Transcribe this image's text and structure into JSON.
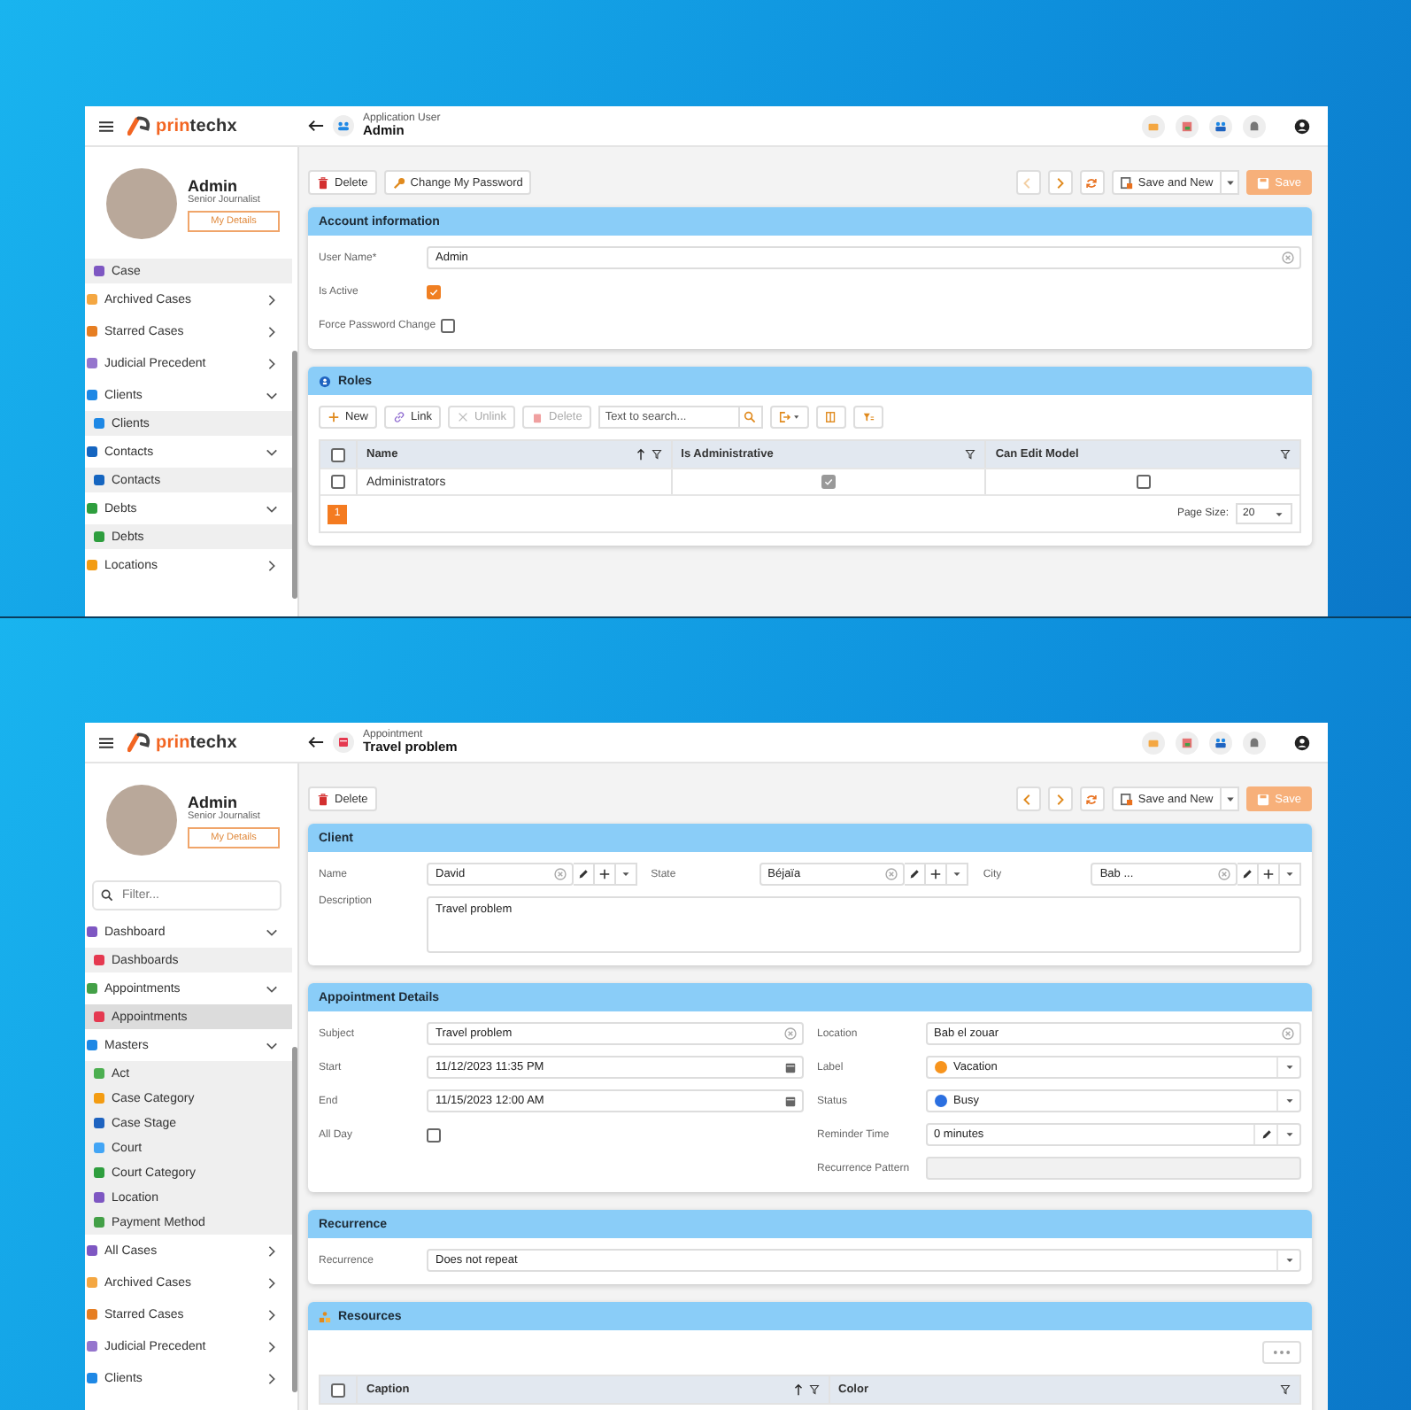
{
  "screens": [
    {
      "logo": {
        "accent": "prin",
        "rest": "techx"
      },
      "profile": {
        "name": "Admin",
        "role": "Senior Journalist",
        "button": "My Details"
      },
      "sidebar": {
        "items": [
          {
            "kind": "child",
            "label": "Case",
            "color": "#7e57c2",
            "selected": false
          },
          {
            "kind": "group",
            "label": "Archived Cases",
            "color": "#f4a742",
            "expanded": false
          },
          {
            "kind": "group",
            "label": "Starred Cases",
            "color": "#e67e22",
            "expanded": false
          },
          {
            "kind": "group",
            "label": "Judicial Precedent",
            "color": "#9575cd",
            "expanded": false
          },
          {
            "kind": "group",
            "label": "Clients",
            "color": "#1e88e5",
            "expanded": true,
            "children": [
              {
                "label": "Clients",
                "color": "#1e88e5",
                "selected": false
              }
            ]
          },
          {
            "kind": "group",
            "label": "Contacts",
            "color": "#1565c0",
            "expanded": true,
            "children": [
              {
                "label": "Contacts",
                "color": "#1565c0",
                "selected": false
              }
            ]
          },
          {
            "kind": "group",
            "label": "Debts",
            "color": "#2e9e3e",
            "expanded": true,
            "children": [
              {
                "label": "Debts",
                "color": "#2e9e3e",
                "selected": false
              }
            ]
          },
          {
            "kind": "group",
            "label": "Locations",
            "color": "#f39c12",
            "expanded": false
          }
        ]
      },
      "header": {
        "subtitle": "Application User",
        "title": "Admin"
      },
      "toolbar": {
        "actions": [
          {
            "kind": "delete",
            "label": "Delete"
          },
          {
            "kind": "password",
            "label": "Change My Password"
          }
        ],
        "prev_disabled": true,
        "next_disabled": false,
        "save_and_new": "Save and New",
        "save": {
          "label": "Save",
          "disabled": true
        }
      },
      "panels": [
        {
          "kind": "form",
          "title": "Account information",
          "sections": [
            {
              "columns": [
                [
                  {
                    "kind": "text",
                    "label": "User Name*",
                    "value": "Admin"
                  },
                  {
                    "kind": "checkbox",
                    "label": "Is Active",
                    "checked": true
                  },
                  {
                    "kind": "checkbox",
                    "label": "Force Password Change",
                    "checked": false
                  }
                ]
              ]
            }
          ]
        },
        {
          "kind": "grid",
          "title": "Roles",
          "toolbar": [
            {
              "kind": "new",
              "label": "New",
              "disabled": false
            },
            {
              "kind": "link",
              "label": "Link",
              "disabled": false
            },
            {
              "kind": "unlink",
              "label": "Unlink",
              "disabled": true
            },
            {
              "kind": "delete",
              "label": "Delete",
              "disabled": true
            },
            {
              "kind": "search",
              "placeholder": "Text to search..."
            },
            {
              "kind": "export"
            },
            {
              "kind": "columns"
            },
            {
              "kind": "filter"
            }
          ],
          "all_selected": false,
          "columns": [
            {
              "label": "Name",
              "sorted": true
            },
            {
              "label": "Is Administrative",
              "sorted": false
            },
            {
              "label": "Can Edit Model",
              "sorted": false
            }
          ],
          "rows": [
            {
              "selected": false,
              "cells": [
                {
                  "kind": "text",
                  "value": "Administrators"
                },
                {
                  "kind": "checkbox",
                  "checked": true
                },
                {
                  "kind": "checkbox",
                  "checked": false
                }
              ]
            }
          ],
          "pager": {
            "pages": [
              {
                "label": "1",
                "selected": true
              }
            ],
            "page_size_label": "Page Size:",
            "page_size": "20"
          }
        }
      ]
    },
    {
      "logo": {
        "accent": "prin",
        "rest": "techx"
      },
      "profile": {
        "name": "Admin",
        "role": "Senior Journalist",
        "button": "My Details"
      },
      "filter": {
        "placeholder": "Filter..."
      },
      "sidebar": {
        "items": [
          {
            "kind": "group",
            "label": "Dashboard",
            "color": "#7e57c2",
            "expanded": true,
            "children": [
              {
                "label": "Dashboards",
                "color": "#e53950",
                "selected": false
              }
            ]
          },
          {
            "kind": "group",
            "label": "Appointments",
            "color": "#43a047",
            "expanded": true,
            "children": [
              {
                "label": "Appointments",
                "color": "#e53950",
                "selected": true
              }
            ]
          },
          {
            "kind": "group",
            "label": "Masters",
            "color": "#1e88e5",
            "expanded": true,
            "children": [
              {
                "label": "Act",
                "color": "#4caf50",
                "selected": false
              },
              {
                "label": "Case Category",
                "color": "#f39c12",
                "selected": false
              },
              {
                "label": "Case Stage",
                "color": "#1e63c0",
                "selected": false
              },
              {
                "label": "Court",
                "color": "#42a5f5",
                "selected": false
              },
              {
                "label": "Court Category",
                "color": "#2e9e3e",
                "selected": false
              },
              {
                "label": "Location",
                "color": "#7e57c2",
                "selected": false
              },
              {
                "label": "Payment Method",
                "color": "#43a047",
                "selected": false
              }
            ]
          },
          {
            "kind": "group",
            "label": "All Cases",
            "color": "#7e57c2",
            "expanded": false
          },
          {
            "kind": "group",
            "label": "Archived Cases",
            "color": "#f4a742",
            "expanded": false
          },
          {
            "kind": "group",
            "label": "Starred Cases",
            "color": "#e67e22",
            "expanded": false
          },
          {
            "kind": "group",
            "label": "Judicial Precedent",
            "color": "#9575cd",
            "expanded": false
          },
          {
            "kind": "group",
            "label": "Clients",
            "color": "#1e88e5",
            "expanded": false
          }
        ]
      },
      "header": {
        "subtitle": "Appointment",
        "title": "Travel problem"
      },
      "toolbar": {
        "actions": [
          {
            "kind": "delete",
            "label": "Delete"
          }
        ],
        "prev_disabled": false,
        "next_disabled": false,
        "save_and_new": "Save and New",
        "save": {
          "label": "Save",
          "disabled": true
        }
      },
      "panels": [
        {
          "kind": "form",
          "title": "Client",
          "sections": [
            {
              "columns": [
                [
                  {
                    "kind": "lookup",
                    "label": "Name",
                    "value": "David"
                  }
                ],
                [
                  {
                    "kind": "lookup",
                    "label": "State",
                    "value": "Béjaïa"
                  }
                ],
                [
                  {
                    "kind": "lookup",
                    "label": "City",
                    "value": "Bab ..."
                  }
                ]
              ]
            },
            {
              "columns": [
                [
                  {
                    "kind": "textarea",
                    "label": "Description",
                    "value": "Travel problem"
                  }
                ]
              ]
            }
          ]
        },
        {
          "kind": "form",
          "title": "Appointment Details",
          "sections": [
            {
              "columns": [
                [
                  {
                    "kind": "text",
                    "label": "Subject",
                    "value": "Travel problem"
                  },
                  {
                    "kind": "date",
                    "label": "Start",
                    "value": "11/12/2023 11:35 PM"
                  },
                  {
                    "kind": "date",
                    "label": "End",
                    "value": "11/15/2023 12:00 AM"
                  },
                  {
                    "kind": "checkbox",
                    "label": "All Day",
                    "checked": false
                  }
                ],
                [
                  {
                    "kind": "text",
                    "label": "Location",
                    "value": "Bab el zouar"
                  },
                  {
                    "kind": "select",
                    "label": "Label",
                    "value": "Vacation",
                    "color": "#f7941d"
                  },
                  {
                    "kind": "select",
                    "label": "Status",
                    "value": "Busy",
                    "color": "#2b6fe0"
                  },
                  {
                    "kind": "select_edit",
                    "label": "Reminder Time",
                    "value": "0 minutes"
                  },
                  {
                    "kind": "disabled",
                    "label": "Recurrence Pattern"
                  }
                ]
              ]
            }
          ]
        },
        {
          "kind": "form",
          "title": "Recurrence",
          "sections": [
            {
              "columns": [
                [
                  {
                    "kind": "select",
                    "label": "Recurrence",
                    "value": "Does not repeat"
                  }
                ]
              ]
            }
          ]
        },
        {
          "kind": "grid",
          "title": "Resources",
          "toolbar": [
            {
              "kind": "more"
            }
          ],
          "all_selected": false,
          "columns": [
            {
              "label": "Caption",
              "sorted": true
            },
            {
              "label": "Color",
              "sorted": false
            }
          ]
        }
      ]
    }
  ]
}
